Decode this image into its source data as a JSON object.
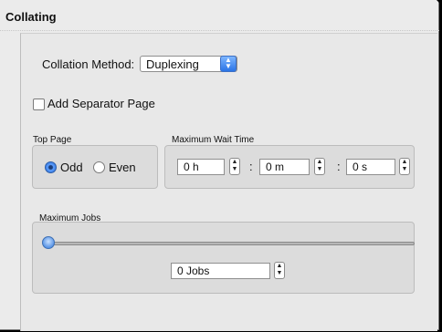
{
  "section": {
    "title": "Collating"
  },
  "collation": {
    "label": "Collation Method:",
    "selected": "Duplexing"
  },
  "separator": {
    "label": "Add Separator Page",
    "checked": false
  },
  "top_page": {
    "group_label": "Top Page",
    "options": [
      {
        "label": "Odd",
        "selected": true
      },
      {
        "label": "Even",
        "selected": false
      }
    ]
  },
  "wait_time": {
    "group_label": "Maximum Wait Time",
    "hours": "0 h",
    "minutes": "0 m",
    "seconds": "0 s",
    "separator": ":"
  },
  "max_jobs": {
    "group_label": "Maximum Jobs",
    "slider_fraction": 0,
    "value": "0 Jobs"
  },
  "icons": {
    "stepper": "up-down-arrows-icon",
    "popup": "popup-arrows-icon"
  }
}
